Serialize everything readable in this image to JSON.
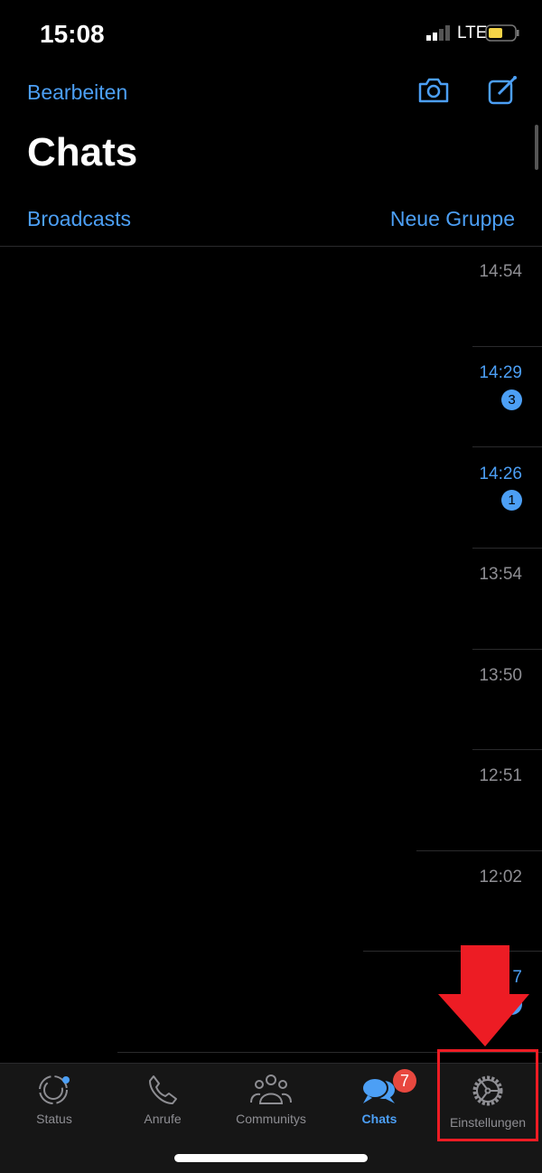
{
  "status_bar": {
    "time": "15:08",
    "network": "LTE",
    "battery_color": "#f5d447"
  },
  "header": {
    "edit": "Bearbeiten",
    "title": "Chats",
    "broadcasts": "Broadcasts",
    "new_group": "Neue Gruppe",
    "camera_icon": "camera-icon",
    "compose_icon": "compose-icon"
  },
  "chats": [
    {
      "time": "14:54",
      "unread": false
    },
    {
      "time": "14:29",
      "unread": true,
      "badge": "3"
    },
    {
      "time": "14:26",
      "unread": true,
      "badge": "1"
    },
    {
      "time": "13:54",
      "unread": false
    },
    {
      "time": "13:50",
      "unread": false
    },
    {
      "time": "12:51",
      "unread": false
    },
    {
      "time": "12:02",
      "unread": false
    },
    {
      "time": "7",
      "unread": true
    }
  ],
  "tabs": [
    {
      "label": "Status",
      "icon": "status-icon"
    },
    {
      "label": "Anrufe",
      "icon": "phone-icon"
    },
    {
      "label": "Communitys",
      "icon": "communities-icon"
    },
    {
      "label": "Chats",
      "icon": "chats-icon",
      "badge": "7",
      "active": true
    },
    {
      "label": "Einstellungen",
      "icon": "gear-icon"
    }
  ],
  "annotation": {
    "color": "#ed1c24",
    "target": "Einstellungen"
  },
  "colors": {
    "accent": "#4c9ff5",
    "badge_red": "#e8483f"
  }
}
